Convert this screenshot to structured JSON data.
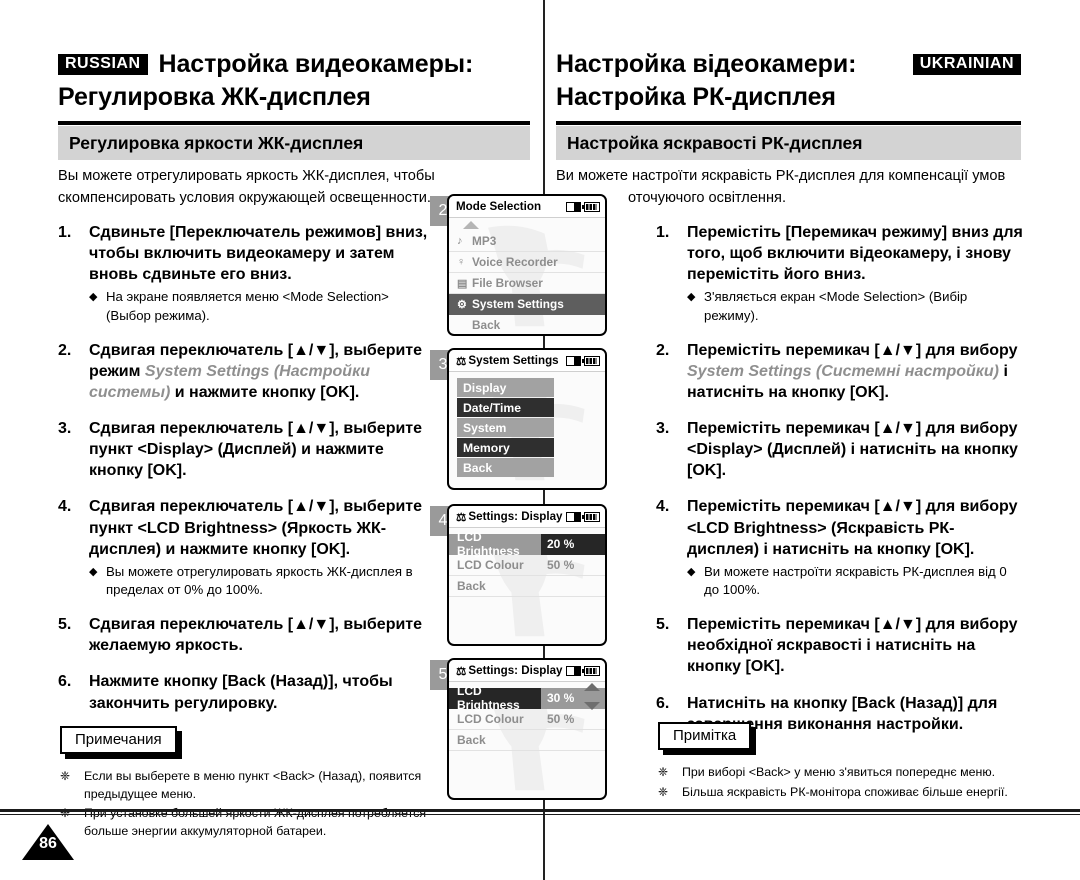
{
  "page": {
    "number": "86"
  },
  "russian": {
    "lang_tag": "RUSSIAN",
    "title_line1": "Настройка видеокамеры:",
    "title_line2": "Регулировка ЖК-дисплея",
    "section_title": "Регулировка яркости ЖК-дисплея",
    "intro_line1": "Вы можете отрегулировать яркость ЖК-дисплея, чтобы",
    "intro_line2": "скомпенсировать условия окружающей освещенности.",
    "steps": [
      {
        "num": "1.",
        "text": "Сдвиньте [Переключатель режимов] вниз, чтобы включить видеокамеру и затем вновь сдвиньте его вниз.",
        "bullets": [
          "На экране появляется меню <Mode Selection> (Выбор режима)."
        ]
      },
      {
        "num": "2.",
        "text_pre": "Сдвигая переключатель [▲/▼], выберите режим ",
        "text_ital": "System Settings (Настройки системы)",
        "text_post": " и нажмите кнопку [OK].",
        "bullets": []
      },
      {
        "num": "3.",
        "text": "Сдвигая переключатель [▲/▼], выберите пункт <Display> (Дисплей) и нажмите кнопку [OK].",
        "bullets": []
      },
      {
        "num": "4.",
        "text": "Сдвигая переключатель [▲/▼], выберите пункт <LCD Brightness> (Яркость ЖК-дисплея) и нажмите кнопку [OK].",
        "bullets": [
          "Вы можете отрегулировать яркость ЖК-дисплея в пределах от 0% до 100%."
        ]
      },
      {
        "num": "5.",
        "text": "Сдвигая переключатель [▲/▼], выберите желаемую яркость.",
        "bullets": []
      },
      {
        "num": "6.",
        "text": "Нажмите кнопку [Back (Назад)], чтобы закончить регулировку.",
        "bullets": []
      }
    ],
    "notes_label": "Примечания",
    "notes": [
      "Если вы выберете в меню пункт <Back> (Назад), появится предыдущее меню.",
      "При установке большей яркости ЖК-дисплея потребляется больше энергии аккумуляторной батареи."
    ]
  },
  "ukrainian": {
    "lang_tag": "UKRAINIAN",
    "title_line1": "Настройка відеокамери:",
    "title_line2": "Настройка РК-дисплея",
    "section_title": "Настройка яскравості РК-дисплея",
    "intro_line1": "Ви можете настроїти яскравість РК-дисплея для компенсації умов",
    "intro_line2": "оточуючого освітлення.",
    "steps": [
      {
        "num": "1.",
        "text": "Перемістіть [Перемикач режиму] вниз для того, щоб включити відеокамеру, і знову перемістіть його вниз.",
        "bullets": [
          "З'являється екран <Mode Selection> (Вибір режиму)."
        ]
      },
      {
        "num": "2.",
        "text_pre": "Перемістіть перемикач [▲/▼] для вибору ",
        "text_ital": "System Settings (Системні настройки)",
        "text_post": " і натисніть на кнопку [OK].",
        "bullets": []
      },
      {
        "num": "3.",
        "text": "Перемістіть перемикач [▲/▼] для вибору <Display> (Дисплей) і натисніть на кнопку [OK].",
        "bullets": []
      },
      {
        "num": "4.",
        "text": "Перемістіть перемикач [▲/▼] для вибору <LCD Brightness> (Яскравість РК-дисплея) і натисніть на кнопку [OK].",
        "bullets": [
          "Ви можете настроїти яскравість РК-дисплея від 0 до 100%."
        ]
      },
      {
        "num": "5.",
        "text": "Перемістіть перемикач [▲/▼] для вибору необхідної яскравості і натисніть на кнопку [OK].",
        "bullets": []
      },
      {
        "num": "6.",
        "text": "Натисніть на кнопку [Back (Назад)] для завершення виконання настройки.",
        "bullets": []
      }
    ],
    "notes_label": "Примітка",
    "notes": [
      "При виборі <Back> у меню з'явиться попереднє меню.",
      "Більша яскравість РК-монітора споживає більше енергії."
    ]
  },
  "screens": [
    {
      "badge": "2",
      "title": "Mode Selection",
      "icons": [
        "memory-card-icon",
        "battery-icon"
      ],
      "type": "mode-list",
      "has_up_arrow": true,
      "items": [
        {
          "icon": "♪",
          "label": "MP3",
          "selected": false
        },
        {
          "icon": "♀",
          "label": "Voice Recorder",
          "selected": false
        },
        {
          "icon": "▤",
          "label": "File Browser",
          "selected": false
        },
        {
          "icon": "⚙",
          "label": "System Settings",
          "selected": true
        },
        {
          "icon": "",
          "label": "Back",
          "selected": false
        }
      ]
    },
    {
      "badge": "3",
      "title": "System Settings",
      "icons": [
        "memory-card-icon",
        "battery-icon"
      ],
      "type": "settings-list",
      "items": [
        {
          "label": "Display",
          "tone": "light"
        },
        {
          "label": "Date/Time",
          "tone": "dark"
        },
        {
          "label": "System",
          "tone": "light"
        },
        {
          "label": "Memory",
          "tone": "dark"
        },
        {
          "label": "Back",
          "tone": "light"
        }
      ]
    },
    {
      "badge": "4",
      "title": "Settings: Display",
      "icons": [
        "memory-card-icon",
        "battery-icon"
      ],
      "type": "value-list",
      "show_scroll": false,
      "rows": [
        {
          "label": "LCD Brightness",
          "value": "20 %",
          "state": "selected-light"
        },
        {
          "label": "LCD Colour",
          "value": "50 %",
          "state": "plain"
        },
        {
          "label": "Back",
          "value": "",
          "state": "plain"
        }
      ]
    },
    {
      "badge": "5",
      "title": "Settings: Display",
      "icons": [
        "memory-card-icon",
        "battery-icon"
      ],
      "type": "value-list",
      "show_scroll": true,
      "rows": [
        {
          "label": "LCD Brightness",
          "value": "30 %",
          "state": "selected-dark"
        },
        {
          "label": "LCD Colour",
          "value": "50 %",
          "state": "plain"
        },
        {
          "label": "Back",
          "value": "",
          "state": "plain"
        }
      ]
    }
  ],
  "colors": {
    "section_bar": "#d3d3d3",
    "badge_gray": "#9a9a9a",
    "selected_dark": "#5e5e5e",
    "text": "#000000",
    "italic_gray": "#8f8f8f"
  }
}
